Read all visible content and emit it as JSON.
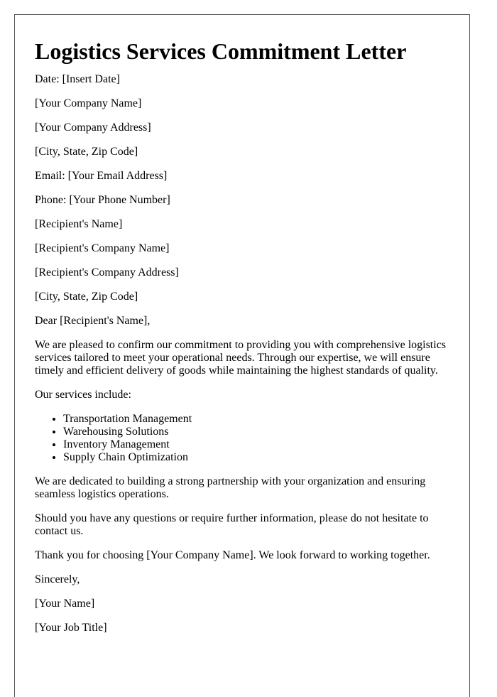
{
  "title": "Logistics Services Commitment Letter",
  "header_lines": [
    "Date: [Insert Date]",
    "[Your Company Name]",
    "[Your Company Address]",
    "[City, State, Zip Code]",
    "Email: [Your Email Address]",
    "Phone: [Your Phone Number]",
    "[Recipient's Name]",
    "[Recipient's Company Name]",
    "[Recipient's Company Address]",
    "[City, State, Zip Code]"
  ],
  "salutation": "Dear [Recipient's Name],",
  "intro_paragraph": "We are pleased to confirm our commitment to providing you with comprehensive logistics services tailored to meet your operational needs. Through our expertise, we will ensure timely and efficient delivery of goods while maintaining the highest standards of quality.",
  "services_intro": "Our services include:",
  "services": [
    "Transportation Management",
    "Warehousing Solutions",
    "Inventory Management",
    "Supply Chain Optimization"
  ],
  "partnership_paragraph": "We are dedicated to building a strong partnership with your organization and ensuring seamless logistics operations.",
  "questions_paragraph": "Should you have any questions or require further information, please do not hesitate to contact us.",
  "thanks_paragraph": "Thank you for choosing [Your Company Name]. We look forward to working together.",
  "closing": "Sincerely,",
  "signature_name": "[Your Name]",
  "signature_title": "[Your Job Title]"
}
